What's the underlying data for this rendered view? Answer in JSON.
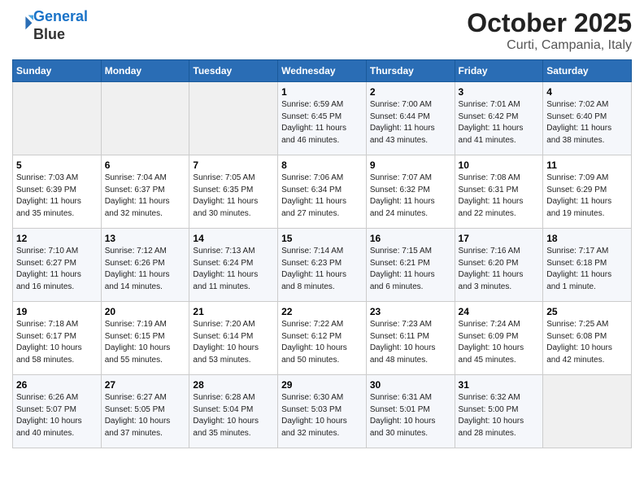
{
  "header": {
    "logo_line1": "General",
    "logo_line2": "Blue",
    "title": "October 2025",
    "subtitle": "Curti, Campania, Italy"
  },
  "days_of_week": [
    "Sunday",
    "Monday",
    "Tuesday",
    "Wednesday",
    "Thursday",
    "Friday",
    "Saturday"
  ],
  "weeks": [
    [
      {
        "day": "",
        "info": ""
      },
      {
        "day": "",
        "info": ""
      },
      {
        "day": "",
        "info": ""
      },
      {
        "day": "1",
        "info": "Sunrise: 6:59 AM\nSunset: 6:45 PM\nDaylight: 11 hours\nand 46 minutes."
      },
      {
        "day": "2",
        "info": "Sunrise: 7:00 AM\nSunset: 6:44 PM\nDaylight: 11 hours\nand 43 minutes."
      },
      {
        "day": "3",
        "info": "Sunrise: 7:01 AM\nSunset: 6:42 PM\nDaylight: 11 hours\nand 41 minutes."
      },
      {
        "day": "4",
        "info": "Sunrise: 7:02 AM\nSunset: 6:40 PM\nDaylight: 11 hours\nand 38 minutes."
      }
    ],
    [
      {
        "day": "5",
        "info": "Sunrise: 7:03 AM\nSunset: 6:39 PM\nDaylight: 11 hours\nand 35 minutes."
      },
      {
        "day": "6",
        "info": "Sunrise: 7:04 AM\nSunset: 6:37 PM\nDaylight: 11 hours\nand 32 minutes."
      },
      {
        "day": "7",
        "info": "Sunrise: 7:05 AM\nSunset: 6:35 PM\nDaylight: 11 hours\nand 30 minutes."
      },
      {
        "day": "8",
        "info": "Sunrise: 7:06 AM\nSunset: 6:34 PM\nDaylight: 11 hours\nand 27 minutes."
      },
      {
        "day": "9",
        "info": "Sunrise: 7:07 AM\nSunset: 6:32 PM\nDaylight: 11 hours\nand 24 minutes."
      },
      {
        "day": "10",
        "info": "Sunrise: 7:08 AM\nSunset: 6:31 PM\nDaylight: 11 hours\nand 22 minutes."
      },
      {
        "day": "11",
        "info": "Sunrise: 7:09 AM\nSunset: 6:29 PM\nDaylight: 11 hours\nand 19 minutes."
      }
    ],
    [
      {
        "day": "12",
        "info": "Sunrise: 7:10 AM\nSunset: 6:27 PM\nDaylight: 11 hours\nand 16 minutes."
      },
      {
        "day": "13",
        "info": "Sunrise: 7:12 AM\nSunset: 6:26 PM\nDaylight: 11 hours\nand 14 minutes."
      },
      {
        "day": "14",
        "info": "Sunrise: 7:13 AM\nSunset: 6:24 PM\nDaylight: 11 hours\nand 11 minutes."
      },
      {
        "day": "15",
        "info": "Sunrise: 7:14 AM\nSunset: 6:23 PM\nDaylight: 11 hours\nand 8 minutes."
      },
      {
        "day": "16",
        "info": "Sunrise: 7:15 AM\nSunset: 6:21 PM\nDaylight: 11 hours\nand 6 minutes."
      },
      {
        "day": "17",
        "info": "Sunrise: 7:16 AM\nSunset: 6:20 PM\nDaylight: 11 hours\nand 3 minutes."
      },
      {
        "day": "18",
        "info": "Sunrise: 7:17 AM\nSunset: 6:18 PM\nDaylight: 11 hours\nand 1 minute."
      }
    ],
    [
      {
        "day": "19",
        "info": "Sunrise: 7:18 AM\nSunset: 6:17 PM\nDaylight: 10 hours\nand 58 minutes."
      },
      {
        "day": "20",
        "info": "Sunrise: 7:19 AM\nSunset: 6:15 PM\nDaylight: 10 hours\nand 55 minutes."
      },
      {
        "day": "21",
        "info": "Sunrise: 7:20 AM\nSunset: 6:14 PM\nDaylight: 10 hours\nand 53 minutes."
      },
      {
        "day": "22",
        "info": "Sunrise: 7:22 AM\nSunset: 6:12 PM\nDaylight: 10 hours\nand 50 minutes."
      },
      {
        "day": "23",
        "info": "Sunrise: 7:23 AM\nSunset: 6:11 PM\nDaylight: 10 hours\nand 48 minutes."
      },
      {
        "day": "24",
        "info": "Sunrise: 7:24 AM\nSunset: 6:09 PM\nDaylight: 10 hours\nand 45 minutes."
      },
      {
        "day": "25",
        "info": "Sunrise: 7:25 AM\nSunset: 6:08 PM\nDaylight: 10 hours\nand 42 minutes."
      }
    ],
    [
      {
        "day": "26",
        "info": "Sunrise: 6:26 AM\nSunset: 5:07 PM\nDaylight: 10 hours\nand 40 minutes."
      },
      {
        "day": "27",
        "info": "Sunrise: 6:27 AM\nSunset: 5:05 PM\nDaylight: 10 hours\nand 37 minutes."
      },
      {
        "day": "28",
        "info": "Sunrise: 6:28 AM\nSunset: 5:04 PM\nDaylight: 10 hours\nand 35 minutes."
      },
      {
        "day": "29",
        "info": "Sunrise: 6:30 AM\nSunset: 5:03 PM\nDaylight: 10 hours\nand 32 minutes."
      },
      {
        "day": "30",
        "info": "Sunrise: 6:31 AM\nSunset: 5:01 PM\nDaylight: 10 hours\nand 30 minutes."
      },
      {
        "day": "31",
        "info": "Sunrise: 6:32 AM\nSunset: 5:00 PM\nDaylight: 10 hours\nand 28 minutes."
      },
      {
        "day": "",
        "info": ""
      }
    ]
  ]
}
